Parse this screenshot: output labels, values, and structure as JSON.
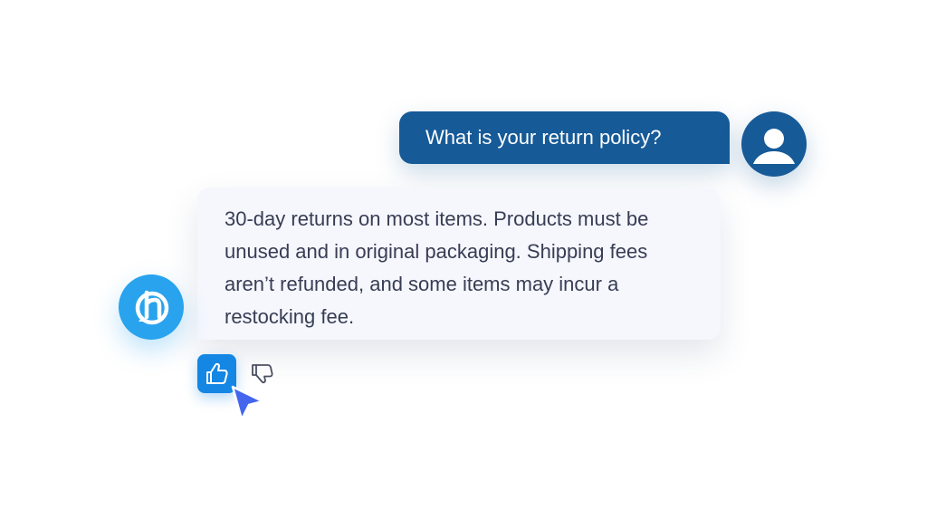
{
  "conversation": {
    "user_message": "What is your return policy?",
    "bot_message": "30-day returns on most items. Products must be unused and in original packaging. Shipping fees aren’t refunded, and some items may incur a restocking fee."
  },
  "icons": {
    "user_avatar": "person-icon",
    "bot_avatar": "chat-logo-icon",
    "feedback_positive": "thumbs-up-icon",
    "feedback_negative": "thumbs-down-icon",
    "pointer": "mouse-cursor-icon"
  },
  "colors": {
    "user_bubble": "#165a98",
    "bot_bubble": "#f5f7fd",
    "bot_avatar": "#29a3ee",
    "thumb_active": "#1486e4",
    "cursor": "#4466ee"
  }
}
